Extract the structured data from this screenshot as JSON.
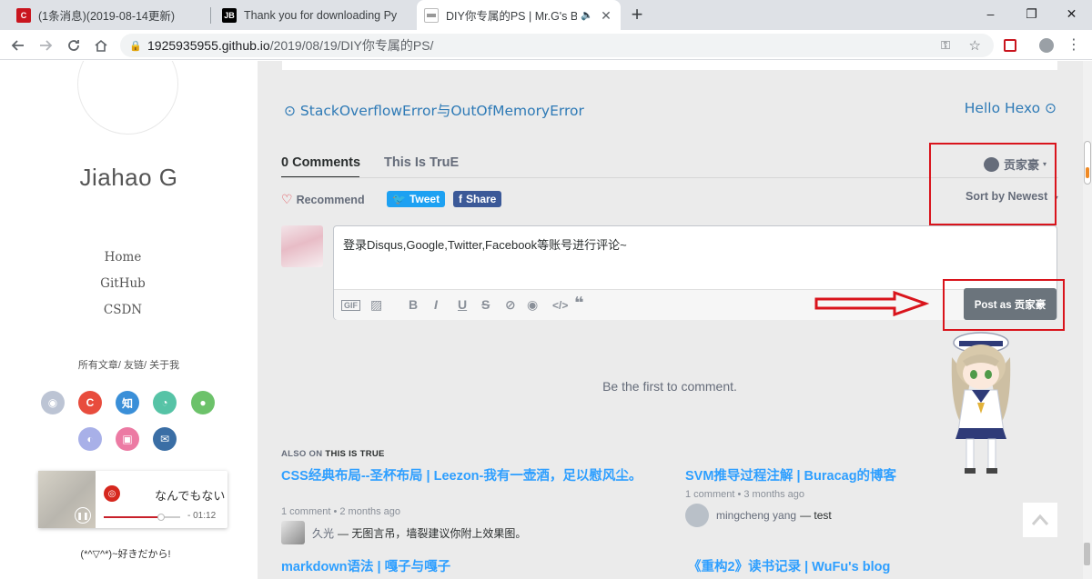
{
  "browser": {
    "tabs": [
      {
        "title": "(1条消息)(2019-08-14更新)",
        "favicon": "C",
        "favicon_color": "#c9151e",
        "active": false
      },
      {
        "title": "Thank you for downloading Py",
        "favicon": "JB",
        "favicon_color": "#000000",
        "active": false
      },
      {
        "title": "DIY你专属的PS | Mr.G's Blo",
        "favicon": "logo",
        "favicon_color": "#777777",
        "active": true
      }
    ],
    "new_tab_label": "+",
    "window_controls": {
      "minimize": "–",
      "restore": "❐",
      "close": "✕"
    },
    "url_host": "1925935955.github.io",
    "url_path": "/2019/08/19/DIY你专属的PS/"
  },
  "sidebar": {
    "site_name": "Jiahao G",
    "nav": [
      {
        "label": "Home"
      },
      {
        "label": "GitHub"
      },
      {
        "label": "CSDN"
      }
    ],
    "sub_links": "所有文章/ 友链/ 关于我",
    "social_icons": [
      {
        "name": "github-icon",
        "glyph": "◉",
        "color": "#bcc4d4"
      },
      {
        "name": "csdn-icon",
        "glyph": "C",
        "color": "#e84c3d"
      },
      {
        "name": "zhihu-icon",
        "glyph": "知",
        "color": "#3a8fd8"
      },
      {
        "name": "qq-icon",
        "glyph": "◔",
        "color": "#56c3a6"
      },
      {
        "name": "wechat-icon",
        "glyph": "●",
        "color": "#6cc26a"
      },
      {
        "name": "weibo-icon",
        "glyph": "◐",
        "color": "#a8b0e8"
      },
      {
        "name": "bilibili-icon",
        "glyph": "▣",
        "color": "#ec7aa3"
      },
      {
        "name": "mail-icon",
        "glyph": "✉",
        "color": "#3a6ea5"
      }
    ],
    "player": {
      "song": "なんでもない",
      "time": "- 01:12",
      "progress": 0.75
    },
    "footer_text": "(*^▽^*)~好きだから!"
  },
  "post_nav": {
    "prev": "⊙ StackOverflowError与OutOfMemoryError",
    "next": "Hello Hexo ⊙"
  },
  "disqus": {
    "tab_comments": "0 Comments",
    "tab_site": "This Is TruE",
    "user": "贡家豪",
    "sort": "Sort by Newest",
    "recommend": "Recommend",
    "tweet": "Tweet",
    "share": "Share",
    "editor_text": "登录Disqus,Google,Twitter,Facebook等账号进行评论~",
    "post_button": "Post as 贡家豪",
    "empty": "Be the first to comment.",
    "also_on_prefix": "ALSO ON",
    "also_on_site": "THIS IS TRUE",
    "related": [
      {
        "title": "CSS经典布局--圣杯布局 | Leezon-我有一壶酒，足以慰风尘。",
        "meta": "1 comment • 2 months ago",
        "commenter": "久光",
        "comment": "— 无图言吊，墙裂建议你附上效果图。"
      },
      {
        "title": "SVM推导过程注解 | Buracag的博客",
        "meta": "1 comment • 3 months ago",
        "commenter": "mingcheng yang",
        "comment": "— test"
      },
      {
        "title": "markdown语法 | 嘎子与嘎子",
        "meta": "",
        "commenter": "",
        "comment": ""
      },
      {
        "title": "《重构2》读书记录 | WuFu's blog",
        "meta": "",
        "commenter": "",
        "comment": ""
      }
    ]
  },
  "colors": {
    "link_blue": "#2e7ab6",
    "related_blue": "#2e9fff",
    "highlight_red": "#d9141c",
    "twitter": "#1da1f2",
    "facebook": "#3b5998"
  }
}
